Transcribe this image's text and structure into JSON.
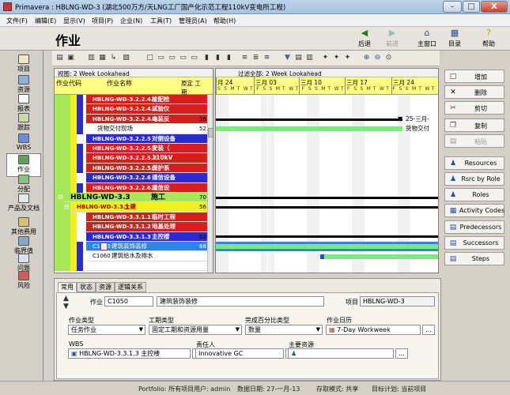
{
  "window": {
    "title": "Primavera : HBLNG-WD-3 (湖北500万方/天LNG工厂国产化示范工程110kV变电所工程)",
    "min": "–",
    "max": "□",
    "close": "X"
  },
  "menu": [
    "文件(F)",
    "编辑(E)",
    "显示(V)",
    "项目(P)",
    "企业(N)",
    "工具(T)",
    "管理员(A)",
    "帮助(H)"
  ],
  "header": {
    "title": "作业",
    "nav": [
      {
        "label": "后退",
        "icon": "back-arrow-icon"
      },
      {
        "label": "前进",
        "icon": "forward-arrow-icon"
      },
      {
        "label": "主窗口",
        "icon": "home-icon"
      },
      {
        "label": "目录",
        "icon": "directory-icon"
      },
      {
        "label": "帮助",
        "icon": "help-icon"
      }
    ]
  },
  "leftnav": [
    {
      "label": "项目",
      "icon": "projects-icon"
    },
    {
      "label": "资源",
      "icon": "resources-icon"
    },
    {
      "label": "报表",
      "icon": "reports-icon"
    },
    {
      "label": "跟踪",
      "icon": "tracking-icon"
    },
    {
      "label": "WBS",
      "icon": "wbs-icon"
    },
    {
      "label": "作业",
      "icon": "activities-icon"
    },
    {
      "label": "分配",
      "icon": "assignments-icon"
    },
    {
      "label": "产品及文档",
      "icon": "work-products-icon"
    },
    {
      "label": "其他费用",
      "icon": "expenses-icon"
    },
    {
      "label": "临界值",
      "icon": "thresholds-icon"
    },
    {
      "label": "问题",
      "icon": "issues-icon"
    },
    {
      "label": "风险",
      "icon": "risks-icon"
    }
  ],
  "grid": {
    "view": "视图: 2 Week Lookahead",
    "filter": "过滤全部: 2 Week Lookahead",
    "col_code": "作业代码",
    "col_name": "作业名称",
    "col_dur": "原定 工期",
    "rows": [
      {
        "code": "HBLNG-WD-3.2.2.4.1",
        "name": "检配检",
        "dur": "",
        "type": "wbs",
        "level": 3
      },
      {
        "code": "HBLNG-WD-3.2.2.4.2",
        "name": "试验仪",
        "dur": "",
        "type": "wbs",
        "level": 3
      },
      {
        "code": "HBLNG-WD-3.2.2.4.3",
        "name": "电装反",
        "dur": "36",
        "type": "wbs",
        "level": 3
      },
      {
        "code": "",
        "name": "货物交付现场",
        "dur": "52",
        "type": "activity",
        "level": 3
      },
      {
        "code": "HBLNG-WD-3.2.2.5",
        "name": "对侧设备",
        "dur": "",
        "type": "wbs-blue",
        "level": 2
      },
      {
        "code": "HBLNG-WD-3.2.2.5.1",
        "name": "安装（",
        "dur": "",
        "type": "wbs",
        "level": 3
      },
      {
        "code": "HBLNG-WD-3.2.2.5.2",
        "name": "110kV",
        "dur": "",
        "type": "wbs",
        "level": 3
      },
      {
        "code": "HBLNG-WD-3.2.2.5.3",
        "name": "保护系",
        "dur": "",
        "type": "wbs",
        "level": 3
      },
      {
        "code": "HBLNG-WD-3.2.2.6",
        "name": "通信设备",
        "dur": "",
        "type": "wbs-blue",
        "level": 2
      },
      {
        "code": "HBLNG-WD-3.2.2.6.1",
        "name": "通信设",
        "dur": "",
        "type": "wbs",
        "level": 3
      },
      {
        "code": "HBLNG-WD-3.3",
        "name": "施工",
        "dur": "70",
        "type": "wbs-green",
        "level": 0
      },
      {
        "code": "HBLNG-WD-3.3.1",
        "name": "土建",
        "dur": "56",
        "type": "wbs-yellow",
        "level": 1
      },
      {
        "code": "HBLNG-WD-3.3.1.1",
        "name": "临时工程",
        "dur": "",
        "type": "wbs",
        "level": 2
      },
      {
        "code": "HBLNG-WD-3.3.1.2",
        "name": "地基处理",
        "dur": "",
        "type": "wbs",
        "level": 2
      },
      {
        "code": "HBLNG-WD-3.3.1.3",
        "name": "主控楼",
        "dur": "52",
        "type": "wbs-blue",
        "level": 2
      },
      {
        "code": "C1050",
        "name": "建筑装饰装修",
        "dur": "68",
        "type": "selected",
        "level": 3
      },
      {
        "code": "C1060",
        "name": "建筑给水及排水",
        "dur": "",
        "type": "activity",
        "level": 3
      },
      {
        "code": "",
        "name": "",
        "dur": "",
        "type": "activity",
        "level": 3
      }
    ]
  },
  "gantt": {
    "months": [
      "月 24",
      "三月 03",
      "三月 10",
      "三月 17",
      "三月 24"
    ],
    "week_letters": "S S M T W T F S S M T W T F S S M T W T F S S M T W T F S S M T W T F",
    "annotations": [
      {
        "row": 2,
        "text": "25-三月-"
      },
      {
        "row": 3,
        "text": "货物交付"
      }
    ]
  },
  "sidebuttons": [
    {
      "label": "增加",
      "icon": "add-icon"
    },
    {
      "label": "删除",
      "icon": "delete-icon"
    },
    {
      "label": "剪切",
      "icon": "cut-icon"
    },
    {
      "label": "复制",
      "icon": "copy-icon"
    },
    {
      "label": "粘贴",
      "icon": "paste-icon"
    },
    {
      "label": "Resources",
      "icon": "resources-icon"
    },
    {
      "label": "Rsrc by Role",
      "icon": "resource-role-icon"
    },
    {
      "label": "Roles",
      "icon": "roles-icon"
    },
    {
      "label": "Activity Codes",
      "icon": "activity-codes-icon"
    },
    {
      "label": "Predecessors",
      "icon": "predecessors-icon"
    },
    {
      "label": "Successors",
      "icon": "successors-icon"
    },
    {
      "label": "Steps",
      "icon": "steps-icon"
    }
  ],
  "detail": {
    "tabs": [
      "常用",
      "状态",
      "资源",
      "逻辑关系"
    ],
    "activity_label": "作业",
    "activity_id": "C1050",
    "activity_name": "建筑装饰装修",
    "project_label": "项目",
    "project_id": "HBLNG-WD-3",
    "type_label": "作业类型",
    "type_value": "任务作业",
    "dur_type_label": "工期类型",
    "dur_type_value": "固定工期和资源用量",
    "pct_label": "完成百分比类型",
    "pct_value": "数量",
    "cal_label": "作业日历",
    "cal_value": "7-Day Workweek",
    "wbs_label": "WBS",
    "wbs_value": "HBLNG-WD-3.3.1.3 主控楼",
    "resp_label": "责任人",
    "resp_value": "Innovative GC",
    "primary_res_label": "主要资源",
    "primary_res_value": "",
    "browse": "..."
  },
  "status": {
    "portfolio": "Portfolio: 所有项目",
    "user": "用户: admin",
    "data_date": "数据日期: 27-一月-13",
    "access": "存取模式: 共享",
    "baseline": "目标计划: 当前项目"
  }
}
